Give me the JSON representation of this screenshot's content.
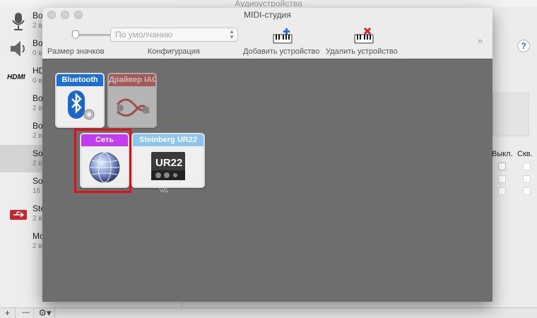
{
  "background_window": {
    "title": "Аудиоустройства",
    "devices": [
      {
        "name": "Bo",
        "sub": "2 в",
        "icon": "microphone-icon"
      },
      {
        "name": "Bo",
        "sub": "0 в",
        "icon": "speaker-icon"
      },
      {
        "name": "HD",
        "sub": "0 в",
        "icon": "hdmi-icon"
      },
      {
        "name": "Bo",
        "sub": "2 в",
        "icon": "none"
      },
      {
        "name": "Bo",
        "sub": "2 в",
        "icon": "none"
      },
      {
        "name": "So",
        "sub": "2 в",
        "icon": "none",
        "selected": true
      },
      {
        "name": "So",
        "sub": "16",
        "icon": "none"
      },
      {
        "name": "Ste",
        "sub": "2 в",
        "icon": "usb-icon"
      },
      {
        "name": "Mo",
        "sub": "2 в",
        "icon": "none"
      }
    ],
    "bottom_buttons": {
      "add": "+",
      "remove": "—",
      "gear": "⚙▾"
    },
    "help_label": "?",
    "columns": {
      "mute": "Выкл.",
      "through": "Скв."
    }
  },
  "midi_window": {
    "title": "MIDI-студия",
    "toolbar": {
      "icon_size_label": "Размер значков",
      "config_label": "Конфигурация",
      "config_value": "По умолчанию",
      "add_device_label": "Добавить устройство",
      "remove_device_label": "Удалить устройство",
      "more": "»"
    },
    "devices": [
      {
        "name": "Bluetooth",
        "color": "#1e6fd3",
        "icon": "bluetooth-icon",
        "dimmed": false
      },
      {
        "name": "Драйвер IAC",
        "color": "#d64a42",
        "icon": "iac-driver-icon",
        "dimmed": true
      },
      {
        "name": "Сеть",
        "color": "#c53bf0",
        "icon": "network-globe-icon",
        "dimmed": false,
        "highlighted": true
      },
      {
        "name": "Steinberg UR22",
        "color": "#8cc5ef",
        "icon": "audio-interface-icon",
        "dimmed": false,
        "badge": "UR22",
        "ports": "▽△"
      }
    ]
  },
  "colors": {
    "highlight": "#e0101a",
    "canvas": "#6e6e6e"
  }
}
